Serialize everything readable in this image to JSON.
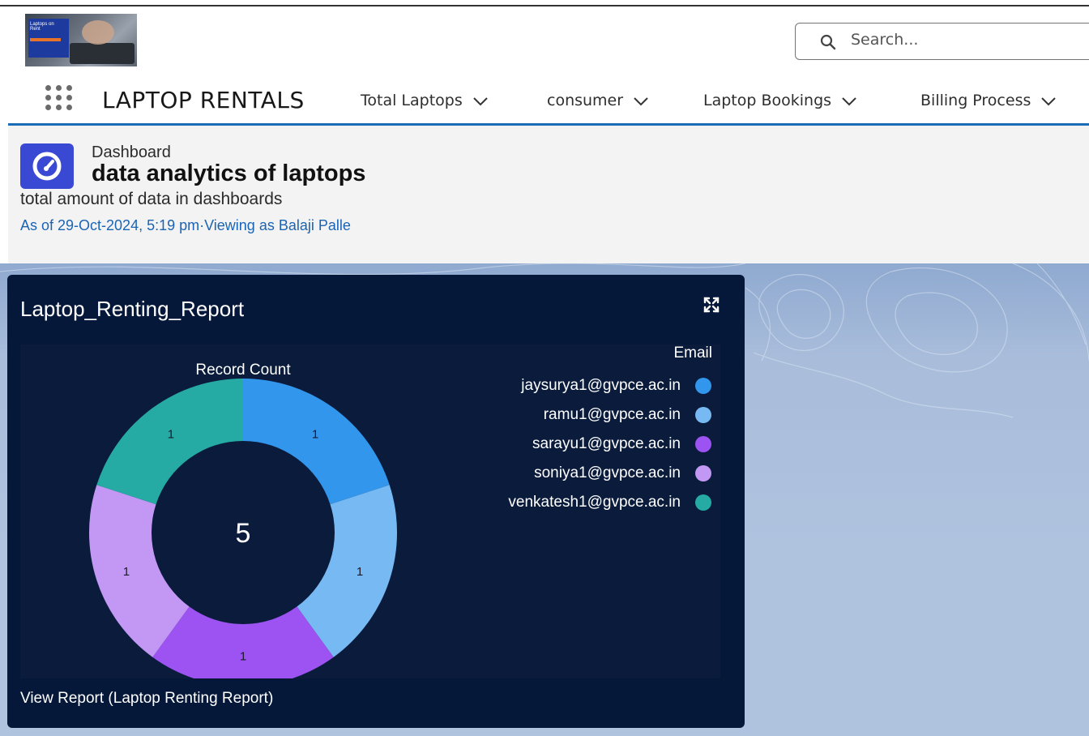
{
  "app": {
    "logo_text": "Laptops on Rent",
    "name": "LAPTOP RENTALS",
    "search_placeholder": "Search..."
  },
  "nav": {
    "items": [
      {
        "label": "Total Laptops"
      },
      {
        "label": "consumer"
      },
      {
        "label": "Laptop Bookings"
      },
      {
        "label": "Billing Process"
      }
    ]
  },
  "header": {
    "type_label": "Dashboard",
    "title": "data analytics of laptops",
    "description": "total amount of data in dashboards",
    "as_of": "As of 29-Oct-2024, 5:19 pm·Viewing as Balaji Palle"
  },
  "card": {
    "title": "Laptop_Renting_Report",
    "view_link": "View Report (Laptop  Renting  Report)"
  },
  "chart_data": {
    "type": "donut",
    "title": "Record Count",
    "total": "5",
    "legend_title": "Email",
    "legend_position": "top-right",
    "slices": [
      {
        "name": "jaysurya1@gvpce.ac.in",
        "value": 1,
        "color": "#3296ed"
      },
      {
        "name": "ramu1@gvpce.ac.in",
        "value": 1,
        "color": "#77b9f2"
      },
      {
        "name": "sarayu1@gvpce.ac.in",
        "value": 1,
        "color": "#9d53f2"
      },
      {
        "name": "soniya1@gvpce.ac.in",
        "value": 1,
        "color": "#c398f5"
      },
      {
        "name": "venkatesh1@gvpce.ac.in",
        "value": 1,
        "color": "#26aba4"
      }
    ]
  }
}
